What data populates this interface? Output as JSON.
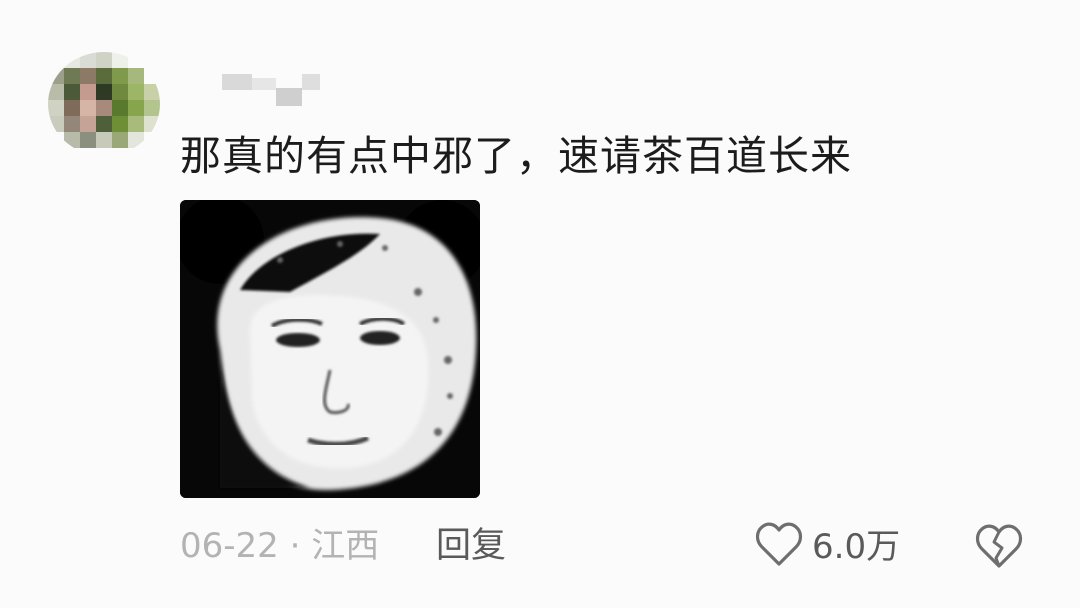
{
  "comment": {
    "text": "那真的有点中邪了，速请茶百道长来",
    "date_location": "06-22 · 江西",
    "reply_label": "回复",
    "like_count": "6.0万",
    "sticker": {
      "description_icon": "meme-sticker-image"
    },
    "icons": {
      "like": "heart-outline-icon",
      "dislike": "broken-heart-icon"
    }
  }
}
